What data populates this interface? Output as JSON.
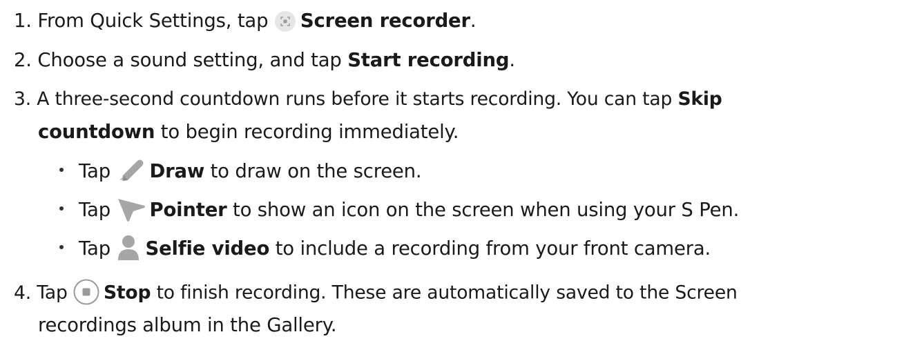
{
  "steps": [
    {
      "number": "1.",
      "before": "From Quick Settings, tap ",
      "icon": "screen-recorder-icon",
      "bold": "Screen recorder",
      "after": "."
    },
    {
      "number": "2.",
      "before": "Choose a sound setting, and tap ",
      "bold": "Start recording",
      "after": "."
    },
    {
      "number": "3.",
      "line1_before": "A three-second countdown runs before it starts recording. You can tap ",
      "line1_bold": "Skip",
      "line2_bold": "countdown",
      "line2_after": " to begin recording immediately.",
      "bullets": [
        {
          "prefix": "Tap ",
          "icon": "pencil-draw-icon",
          "bold": "Draw",
          "after": " to draw on the screen."
        },
        {
          "prefix": "Tap ",
          "icon": "pointer-icon",
          "bold": "Pointer",
          "after": " to show an icon on the screen when using your S Pen."
        },
        {
          "prefix": "Tap ",
          "icon": "person-selfie-icon",
          "bold": "Selfie video",
          "after": " to include a recording from your front camera."
        }
      ]
    },
    {
      "number": "4.",
      "line1_before": "Tap ",
      "icon": "stop-icon",
      "line1_bold": "Stop",
      "line1_after": " to finish recording. These are automatically saved to the Screen",
      "line2": "recordings album in the Gallery."
    }
  ],
  "colors": {
    "text": "#1a1a1a",
    "icon_gray": "#9a9a9a",
    "icon_circle_bg": "#e6e6e6"
  }
}
